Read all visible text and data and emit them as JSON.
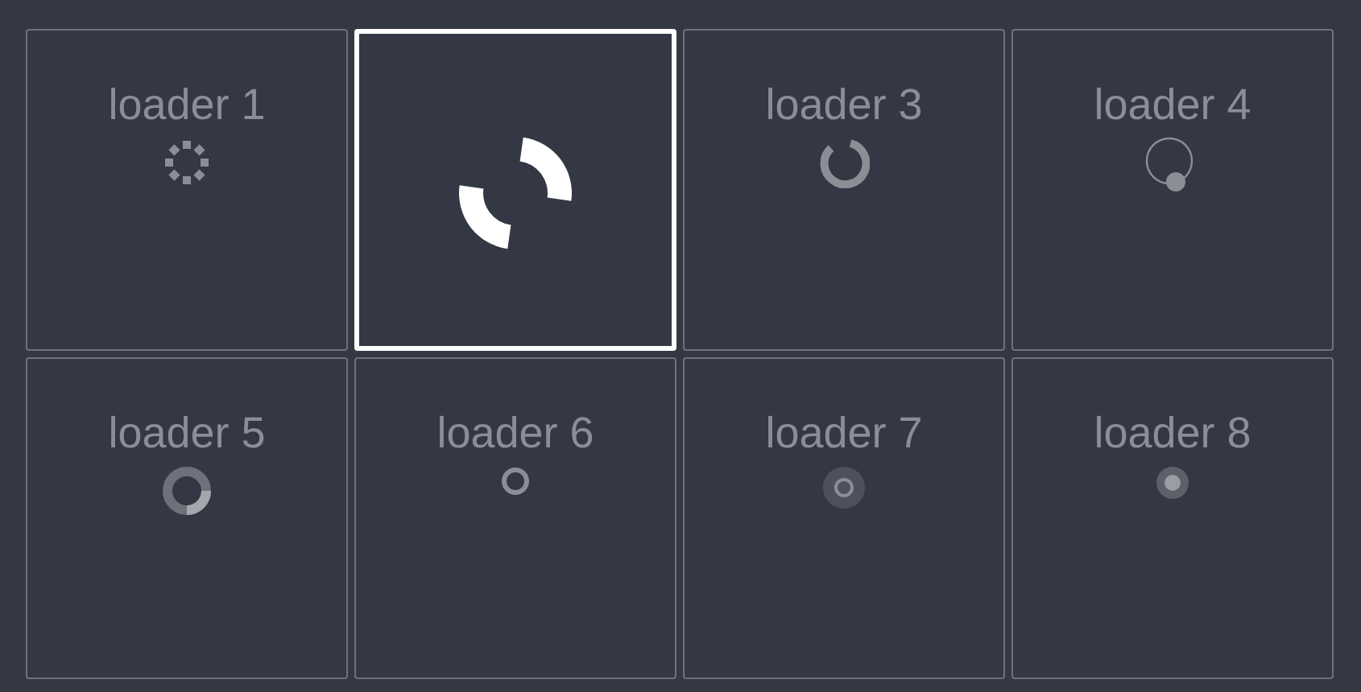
{
  "loaders": [
    {
      "label": "loader 1",
      "kind": "dots",
      "selected": false
    },
    {
      "kind": "arcs",
      "selected": true
    },
    {
      "label": "loader 3",
      "kind": "gap-ring",
      "selected": false
    },
    {
      "label": "loader 4",
      "kind": "orbit",
      "selected": false
    },
    {
      "label": "loader 5",
      "kind": "donut",
      "selected": false
    },
    {
      "label": "loader 6",
      "kind": "ring",
      "selected": false
    },
    {
      "label": "loader 7",
      "kind": "double-ring",
      "selected": false
    },
    {
      "label": "loader 8",
      "kind": "dot-ring",
      "selected": false
    }
  ]
}
